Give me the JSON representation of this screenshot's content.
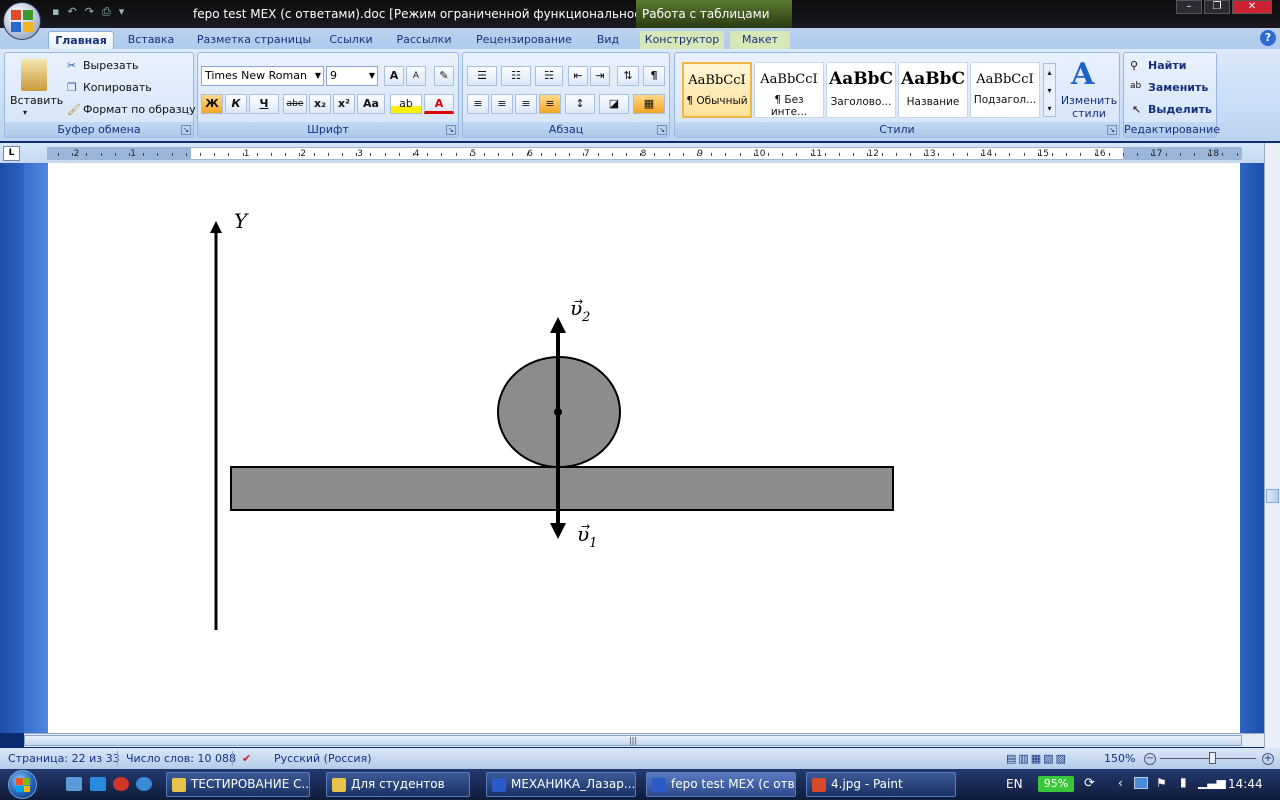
{
  "window": {
    "title": "fepo test MEX (с ответами).doc [Режим ограниченной функциональности] - M",
    "context_tab_title": "Работа с таблицами"
  },
  "tabs": [
    {
      "label": "Главная",
      "active": true
    },
    {
      "label": "Вставка"
    },
    {
      "label": "Разметка страницы"
    },
    {
      "label": "Ссылки"
    },
    {
      "label": "Рассылки"
    },
    {
      "label": "Рецензирование"
    },
    {
      "label": "Вид"
    },
    {
      "label": "Конструктор"
    },
    {
      "label": "Макет"
    }
  ],
  "ribbon": {
    "clipboard": {
      "group_label": "Буфер обмена",
      "paste": "Вставить",
      "cut": "Вырезать",
      "copy": "Копировать",
      "format_painter": "Формат по образцу"
    },
    "font": {
      "group_label": "Шрифт",
      "font_name": "Times New Roman",
      "font_size": "9",
      "bold": "Ж",
      "italic": "К",
      "underline": "Ч",
      "strike": "abe",
      "subscript": "x₂",
      "superscript": "x²",
      "change_case": "Aa",
      "grow": "A",
      "shrink": "A"
    },
    "paragraph": {
      "group_label": "Абзац",
      "pilcrow": "¶"
    },
    "styles": {
      "group_label": "Стили",
      "items": [
        {
          "sample": "AaBbCcI",
          "name": "¶ Обычный",
          "active": true
        },
        {
          "sample": "AaBbCcI",
          "name": "¶ Без инте..."
        },
        {
          "sample": "AaBbC",
          "name": "Заголово..."
        },
        {
          "sample": "AaBbC",
          "name": "Название"
        },
        {
          "sample": "AaBbCcI",
          "name": "Подзагол..."
        }
      ],
      "change_styles": "Изменить стили"
    },
    "editing": {
      "group_label": "Редактирование",
      "find": "Найти",
      "replace": "Заменить",
      "select": "Выделить"
    }
  },
  "ruler": {
    "left_numbers": [
      "2",
      "1"
    ],
    "right_numbers": [
      "1",
      "2",
      "3",
      "4",
      "5",
      "6",
      "7",
      "8",
      "9",
      "10",
      "11",
      "12",
      "13",
      "14",
      "15",
      "16",
      "17",
      "18"
    ]
  },
  "diagram": {
    "y_axis_label": "Y",
    "v2_label": "υ",
    "v2_sub": "2",
    "v1_label": "υ",
    "v1_sub": "1",
    "shape_fill": "#8c8c8c"
  },
  "statusbar": {
    "page": "Страница: 22 из 33",
    "words": "Число слов: 10 088",
    "language": "Русский (Россия)",
    "zoom": "150%"
  },
  "taskbar": {
    "items": [
      {
        "label": "ТЕСТИРОВАНИЕ С...",
        "icon_color": "#e8c24a"
      },
      {
        "label": "Для студентов",
        "icon_color": "#e8c24a"
      },
      {
        "label": "МЕХАНИКА_Лазар...",
        "icon_color": "#2a5bc8"
      },
      {
        "label": "fepo test MEX (с отв...",
        "icon_color": "#2a5bc8"
      },
      {
        "label": "4.jpg - Paint",
        "icon_color": "#d84a2a"
      }
    ],
    "lang": "EN",
    "battery": "95%",
    "time": "14:44"
  }
}
